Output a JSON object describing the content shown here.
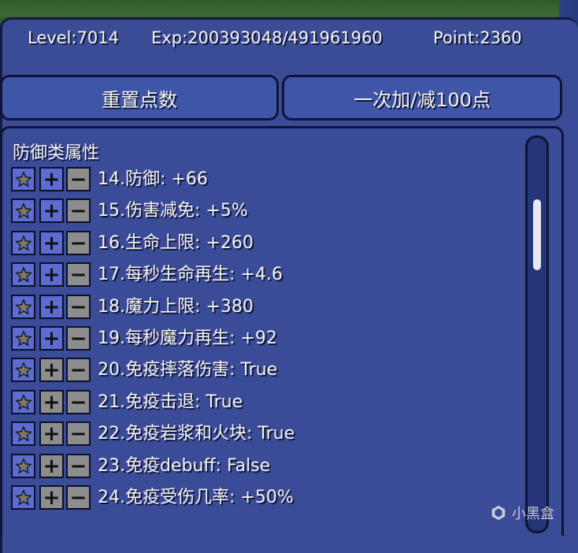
{
  "stats": {
    "level": "Level:7014",
    "exp": "Exp:200393048/491961960",
    "point": "Point:2360"
  },
  "buttons": {
    "reset": "重置点数",
    "toggle_step": "一次加/减100点"
  },
  "section_title": "防御类属性",
  "attributes": [
    "14.防御: +66",
    "15.伤害减免: +5%",
    "16.生命上限: +260",
    "17.每秒生命再生: +4.6",
    "18.魔力上限: +380",
    "19.每秒魔力再生: +92",
    "20.免疫摔落伤害: True",
    "21.免疫击退: True",
    "22.免疫岩浆和火块: True",
    "23.免疫debuff: False",
    "24.免疫受伤几率: +50%"
  ],
  "row_icons": {
    "favorite": "star-icon",
    "increase": "plus-icon",
    "decrease": "minus-icon"
  },
  "scroll_position": 0.18,
  "watermark": "小黑盒",
  "colors": {
    "panel": "#3b4c96",
    "border": "#0f1436",
    "button_active": "#5d6cd4",
    "button_inactive": "#8d8d8d",
    "text": "#f4f4f4"
  }
}
